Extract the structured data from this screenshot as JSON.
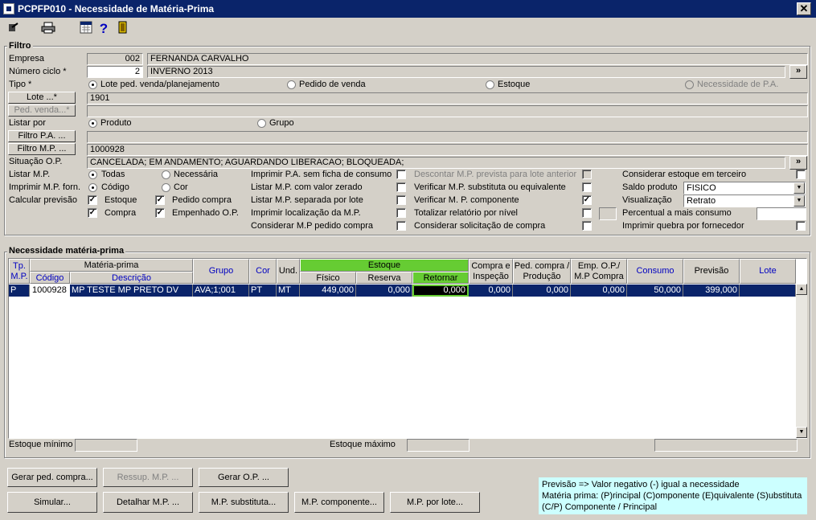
{
  "window": {
    "title": "PCPFP010 - Necessidade de Matéria-Prima",
    "close_glyph": "✕"
  },
  "toolbar": {
    "icons": [
      "exit-icon",
      "printer-icon",
      "calculator-icon",
      "help-icon",
      "door-icon"
    ],
    "help_glyph": "?"
  },
  "filter": {
    "title": "Filtro",
    "empresa_label": "Empresa",
    "empresa_code": "002",
    "empresa_name": "FERNANDA CARVALHO",
    "ciclo_label": "Número ciclo *",
    "ciclo_value": "2",
    "ciclo_name": "INVERNO 2013",
    "tipo_label": "Tipo *",
    "tipo_options": [
      "Lote ped. venda/planejamento",
      "Pedido de venda",
      "Estoque",
      "Necessidade de P.A."
    ],
    "lote_button": "Lote ...*",
    "lote_value": "1901",
    "ped_venda_button": "Ped. venda...*",
    "listar_por_label": "Listar por",
    "listar_por_options": [
      "Produto",
      "Grupo"
    ],
    "filtro_pa_button": "Filtro P.A. ...",
    "filtro_mp_button": "Filtro M.P. ...",
    "filtro_mp_value": "1000928",
    "situacao_label": "Situação O.P.",
    "situacao_value": "CANCELADA; EM ANDAMENTO; AGUARDANDO LIBERACAO; BLOQUEADA;",
    "more_glyph": "»",
    "listar_mp_label": "Listar M.P.",
    "listar_mp_options": [
      "Todas",
      "Necessária"
    ],
    "imprimir_forn_label": "Imprimir M.P. forn.",
    "imprimir_forn_options": [
      "Código",
      "Cor"
    ],
    "calcular_label": "Calcular previsão",
    "calc_checks": [
      "Estoque",
      "Pedido compra",
      "Compra",
      "Empenhado O.P."
    ],
    "col2_checks": [
      "Imprimir P.A. sem ficha de consumo",
      "Listar M.P. com valor zerado",
      "Listar M.P. separada por lote",
      "Imprimir localização da M.P.",
      "Considerar M.P pedido compra"
    ],
    "col3_checks": [
      "Descontar M.P. prevista para lote anterior",
      "Verificar M.P. substituta ou equivalente",
      "Verificar M. P. componente",
      "Totalizar relatório por nível",
      "Considerar solicitação de compra"
    ],
    "considerar_terceiro": "Considerar estoque em terceiro",
    "saldo_label": "Saldo produto",
    "saldo_value": "FISICO",
    "visualizacao_label": "Visualização",
    "visualizacao_value": "Retrato",
    "percentual_label": "Percentual a mais consumo",
    "quebra_label": "Imprimir quebra por fornecedor",
    "check_glyph": "✓"
  },
  "grid": {
    "title": "Necessidade matéria-prima",
    "headers": {
      "tp_mp": "Tp. M.P.",
      "materia_prima": "Matéria-prima",
      "codigo": "Código",
      "descricao": "Descrição",
      "grupo": "Grupo",
      "cor": "Cor",
      "und": "Und.",
      "estoque": "Estoque",
      "fisico": "Físico",
      "reserva": "Reserva",
      "retornar": "Retornar",
      "compra_insp": "Compra e Inspeção",
      "ped_compra": "Ped. compra / Produção",
      "emp_op": "Emp. O.P./ M.P Compra",
      "consumo": "Consumo",
      "previsao": "Previsão",
      "lote": "Lote"
    },
    "rows": [
      {
        "tp": "P",
        "codigo": "1000928",
        "descricao": "MP TESTE MP PRETO DV",
        "grupo": "AVA;1;001",
        "cor": "PT",
        "und": "MT",
        "fisico": "449,000",
        "reserva": "0,000",
        "retornar": "0,000",
        "compra": "0,000",
        "ped": "0,000",
        "emp": "0,000",
        "consumo": "50,000",
        "previsao": "399,000",
        "lote": ""
      }
    ],
    "estoque_minimo_label": "Estoque mínimo",
    "estoque_maximo_label": "Estoque máximo",
    "scroll_up": "▲",
    "scroll_down": "▼"
  },
  "buttons": {
    "gerar_ped": "Gerar ped. compra...",
    "ressup": "Ressup. M.P. ...",
    "gerar_op": "Gerar O.P. ...",
    "simular": "Simular...",
    "detalhar": "Detalhar M.P. ...",
    "substituta": "M.P. substituta...",
    "componente": "M.P. componente...",
    "por_lote": "M.P. por lote..."
  },
  "notes": {
    "line1": "Previsão => Valor negativo (-) igual a necessidade",
    "line2": "Matéria prima: (P)rincipal (C)omponente (E)quivalente (S)ubstituta",
    "line3": "(C/P) Componente / Principal"
  },
  "colors": {
    "title_bar": "#0a246a",
    "selection": "#0a246a",
    "estoque_header": "#66cc33",
    "note_bg": "#ccffff"
  }
}
